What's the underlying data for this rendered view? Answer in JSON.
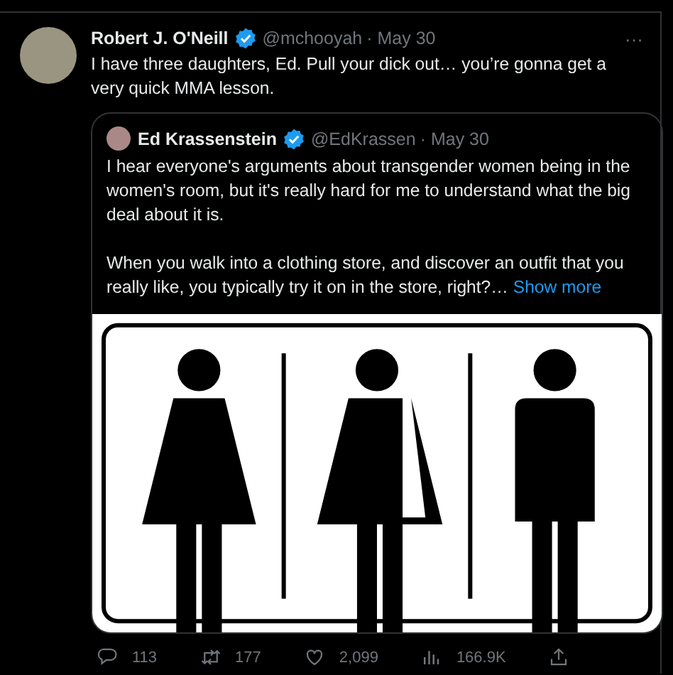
{
  "tweet": {
    "author": {
      "name": "Robert J. O'Neill",
      "verified": true,
      "handle": "@mchooyah",
      "date": "· May 30"
    },
    "more": "···",
    "text": "I have three daughters, Ed. Pull your dick out… you’re gonna get a very quick MMA lesson.",
    "quote": {
      "author": {
        "name": "Ed Krassenstein",
        "verified": true,
        "handle": "@EdKrassen",
        "date": "· May 30"
      },
      "paragraphs": [
        "I hear everyone's arguments about transgender women being in the women's room, but it's really hard for me to understand what the big deal about it is.",
        "When you walk into a clothing store, and discover an outfit that you really like, you typically try it on in the store, right?…"
      ],
      "show_more": "Show more"
    },
    "actions": [
      {
        "kind": "reply",
        "count": "113"
      },
      {
        "kind": "retweet",
        "count": "177"
      },
      {
        "kind": "like",
        "count": "2,099"
      },
      {
        "kind": "views",
        "count": "166.9K"
      },
      {
        "kind": "share"
      }
    ]
  }
}
